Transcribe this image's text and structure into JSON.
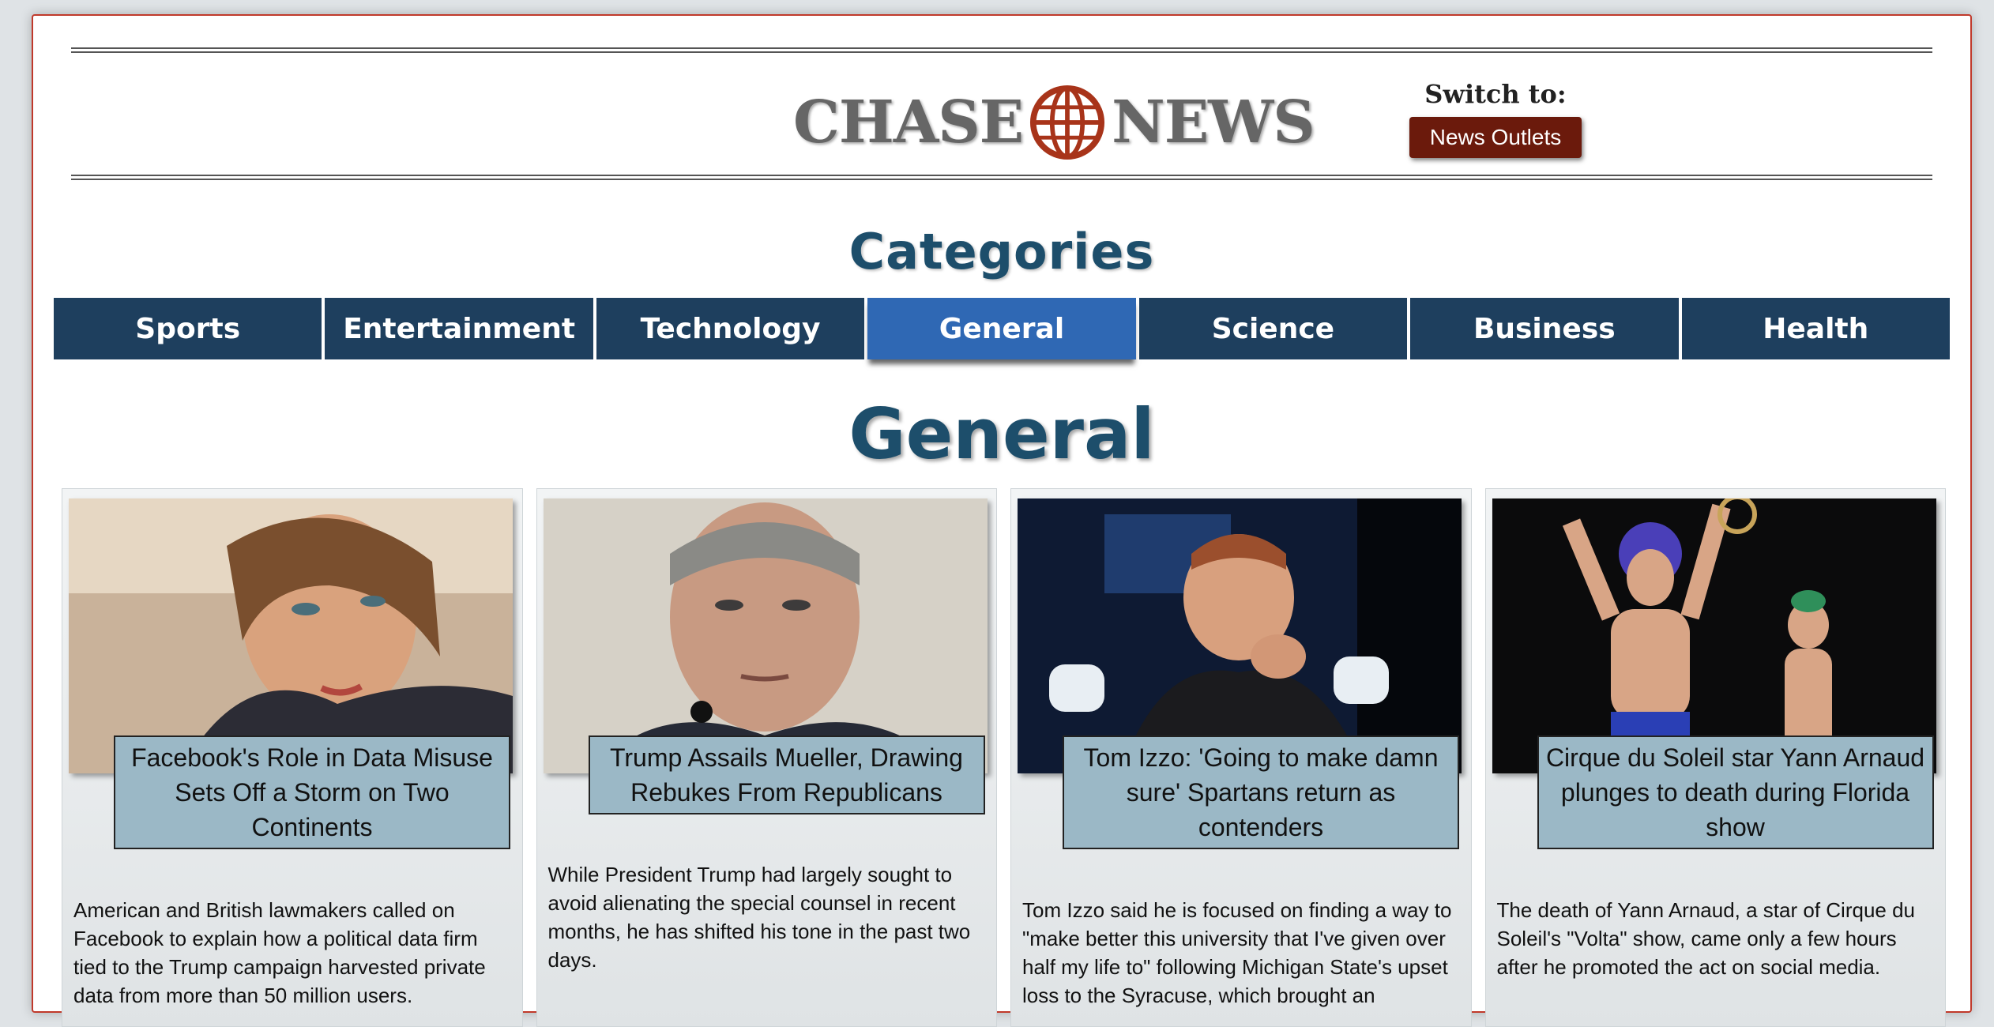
{
  "site": {
    "logo_left": "CHASE",
    "logo_right": "NEWS",
    "switch_label": "Switch to:",
    "switch_button": "News Outlets",
    "brand_color": "#a8341a"
  },
  "categories": {
    "heading": "Categories",
    "tabs": [
      "Sports",
      "Entertainment",
      "Technology",
      "General",
      "Science",
      "Business",
      "Health"
    ],
    "active": "General"
  },
  "section": {
    "title": "General"
  },
  "articles": [
    {
      "image": "woman-portrait-photo",
      "title": "Facebook's Role in Data Misuse Sets Off a Storm on Two Continents",
      "summary": "American and British lawmakers called on Facebook to explain how a political data firm tied to the Trump campaign harvested private data from more than 50 million users."
    },
    {
      "image": "man-portrait-photo",
      "title": "Trump Assails Mueller, Drawing Rebukes From Republicans",
      "summary": "While President Trump had largely sought to avoid alienating the special counsel in recent months, he has shifted his tone in the past two days."
    },
    {
      "image": "press-conference-photo",
      "title": "Tom Izzo: 'Going to make damn sure' Spartans return as contenders",
      "summary": "Tom Izzo said he is focused on finding a way to \"make better this university that I've given over half my life to\" following Michigan State's upset loss to the Syracuse, which brought an"
    },
    {
      "image": "acrobats-photo",
      "title": "Cirque du Soleil star Yann Arnaud plunges to death during Florida show",
      "summary": "The death of Yann Arnaud, a star of Cirque du Soleil's \"Volta\" show, came only a few hours after he promoted the act on social media."
    }
  ]
}
